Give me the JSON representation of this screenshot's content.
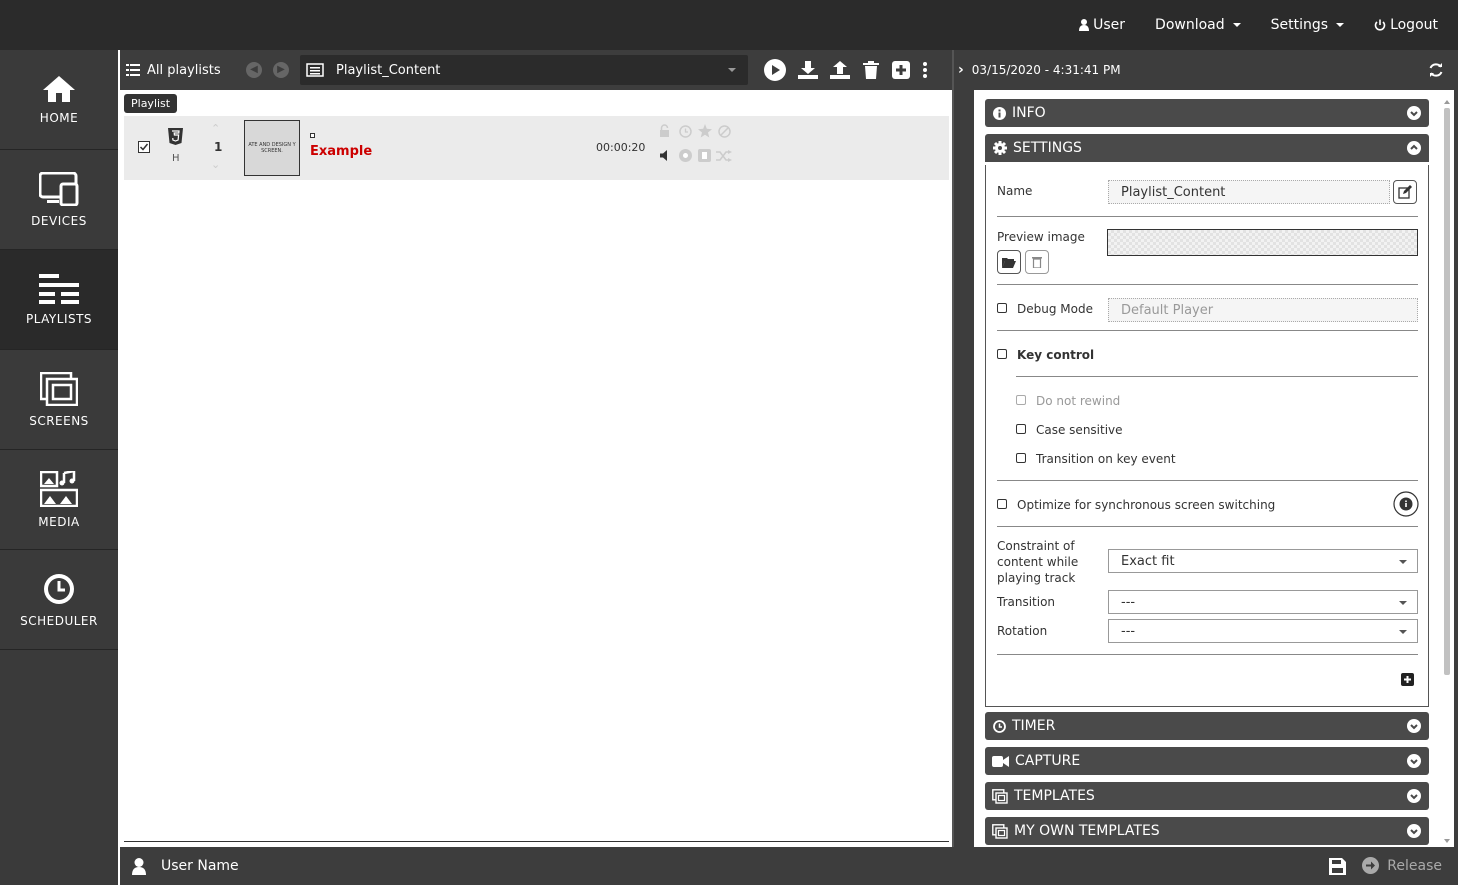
{
  "topnav": {
    "user": "User",
    "download": "Download",
    "settings": "Settings",
    "logout": "Logout"
  },
  "sidebar": {
    "items": [
      {
        "label": "HOME"
      },
      {
        "label": "DEVICES"
      },
      {
        "label": "PLAYLISTS"
      },
      {
        "label": "SCREENS"
      },
      {
        "label": "MEDIA"
      },
      {
        "label": "SCHEDULER"
      }
    ]
  },
  "playlist_bar": {
    "all_playlists": "All playlists",
    "selected": "Playlist_Content"
  },
  "tooltip": "Playlist",
  "row": {
    "type_letter": "H",
    "index": "1",
    "thumb_text": "ATE AND DESIGN Y SCREEN.",
    "title": "Example",
    "duration": "00:00:20"
  },
  "right": {
    "timestamp": "03/15/2020 - 4:31:41 PM",
    "sections": {
      "info": "INFO",
      "settings": "SETTINGS",
      "timer": "TIMER",
      "capture": "CAPTURE",
      "templates": "TEMPLATES",
      "my_templates": "MY OWN TEMPLATES"
    },
    "form": {
      "name_label": "Name",
      "name_value": "Playlist_Content",
      "preview_label": "Preview image",
      "debug_label": "Debug Mode",
      "debug_placeholder": "Default Player",
      "key_control": "Key control",
      "do_not_rewind": "Do not rewind",
      "case_sensitive": "Case sensitive",
      "transition_key": "Transition on key event",
      "optimize": "Optimize for synchronous screen switching",
      "constraint_l1": "Constraint of",
      "constraint_l2": "content while",
      "constraint_l3": "playing track",
      "constraint_value": "Exact fit",
      "transition_label": "Transition",
      "transition_value": "---",
      "rotation_label": "Rotation",
      "rotation_value": "---"
    }
  },
  "footer": {
    "user_name": "User Name",
    "release": "Release"
  },
  "colors": {
    "accent_red": "#cc0000",
    "dark": "#2b2b2b",
    "panel": "#3d3d3d"
  }
}
